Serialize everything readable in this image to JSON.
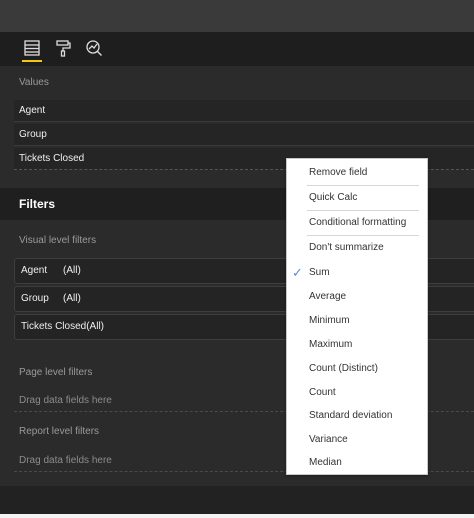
{
  "values_section": {
    "label": "Values",
    "fields": [
      "Agent",
      "Group",
      "Tickets Closed"
    ]
  },
  "filters": {
    "title": "Filters",
    "visual_label": "Visual level filters",
    "visual_filters": [
      {
        "field": "Agent",
        "value": "(All)"
      },
      {
        "field": "Group",
        "value": "(All)"
      },
      {
        "field": "Tickets Closed",
        "value": "(All)"
      }
    ],
    "page_label": "Page level filters",
    "page_drop": "Drag data fields here",
    "report_label": "Report level filters",
    "report_drop": "Drag data fields here"
  },
  "context_menu": {
    "items": [
      "Remove field",
      "Quick Calc",
      "Conditional formatting",
      "Don't summarize",
      "Sum",
      "Average",
      "Minimum",
      "Maximum",
      "Count (Distinct)",
      "Count",
      "Standard deviation",
      "Variance",
      "Median"
    ],
    "checked": "Sum",
    "check_glyph": "✓"
  },
  "colors": {
    "panel_bg": "#2b2b2b",
    "accent": "#f2c811",
    "menu_bg": "#ffffff",
    "check": "#5a8fd1"
  }
}
